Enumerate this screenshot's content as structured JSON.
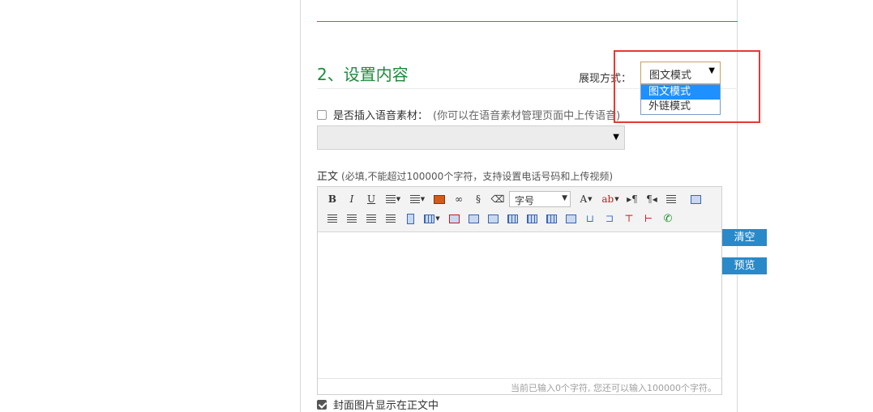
{
  "section": {
    "title": "2、设置内容",
    "display_label": "展现方式：",
    "display_selected": "图文模式",
    "display_options": [
      "图文模式",
      "外链模式"
    ]
  },
  "voice": {
    "label": "是否插入语音素材：",
    "hint": "(你可以在语音素材管理页面中上传语音)",
    "select_value": ""
  },
  "body_field": {
    "label": "正文",
    "hint": "(必填,不能超过100000个字符，支持设置电话号码和上传视频)"
  },
  "toolbar": {
    "bold": "B",
    "italic": "I",
    "underline": "U",
    "font_size_label": "字号",
    "font_color": "A",
    "ltr": "▸¶",
    "rtl": "¶◂"
  },
  "editor": {
    "counter_text": "当前已输入0个字符, 您还可以输入100000个字符。"
  },
  "actions": {
    "clear_label": "清空",
    "preview_label": "预览"
  },
  "cover": {
    "label": "封面图片显示在正文中",
    "checked": true
  },
  "colors": {
    "title_green": "#1d8a3c",
    "button_blue": "#2a8ac9",
    "highlight_red": "#e53935",
    "selected_option": "#1e90ff"
  }
}
